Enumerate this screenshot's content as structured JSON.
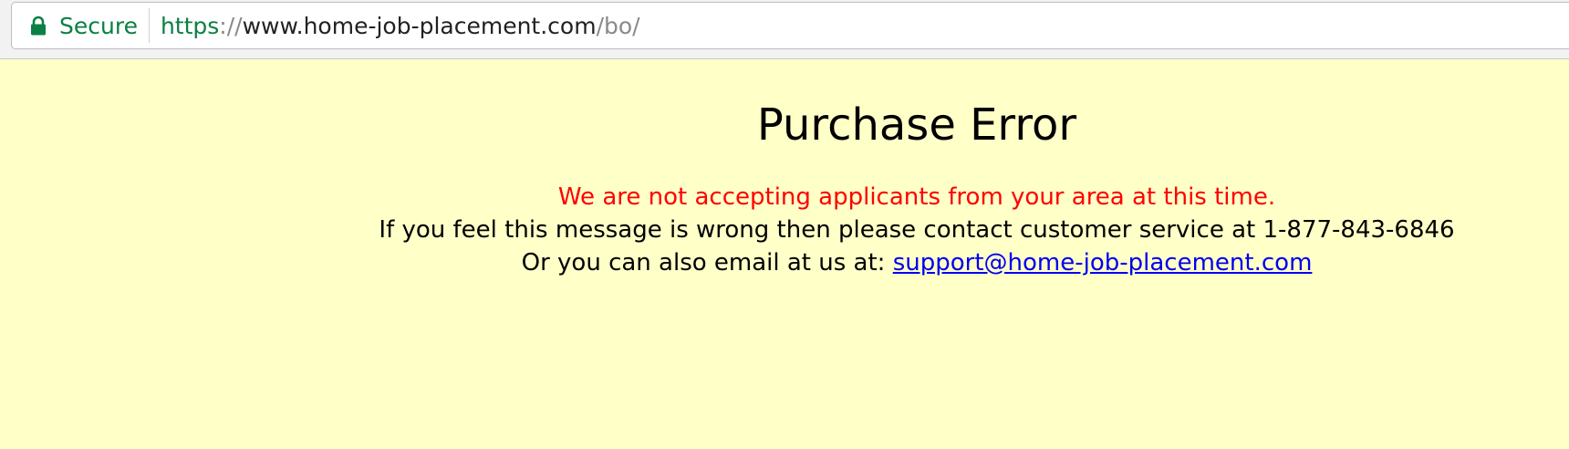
{
  "browser": {
    "secure_label": "Secure",
    "lock_icon": "lock-icon",
    "secure_color": "#0b8043",
    "url": {
      "scheme": "https",
      "separator": "://",
      "host": "www.home-job-placement.com",
      "path": "/bo/"
    }
  },
  "page": {
    "background_color": "#ffffc8",
    "title": "Purchase Error",
    "error_message": "We are not accepting applicants from your area at this time.",
    "error_color": "#ff0000",
    "contact_line": "If you feel this message is wrong then please contact customer service at 1-877-843-6846",
    "email_prefix": "Or you can also email at us at: ",
    "email_link": "support@home-job-placement.com",
    "link_color": "#0000ee"
  }
}
